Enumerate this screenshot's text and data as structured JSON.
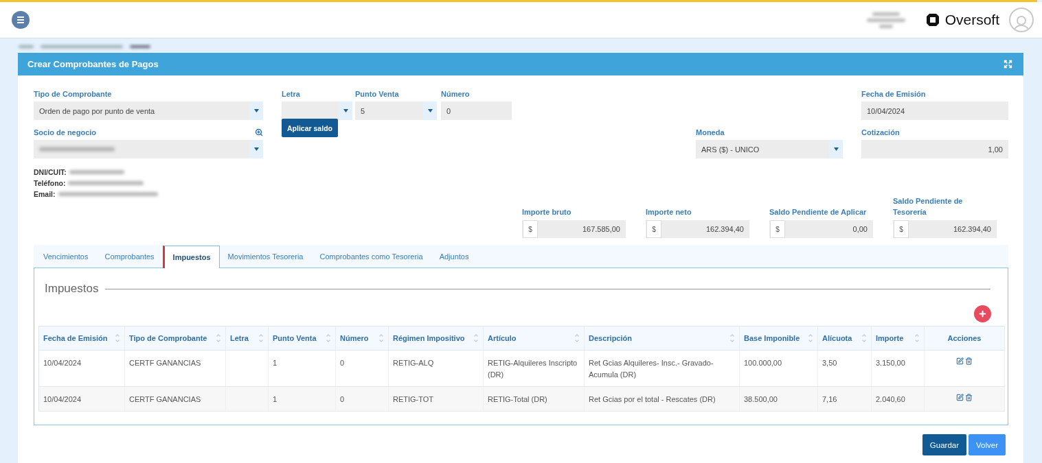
{
  "header": {
    "brand": "Oversoft",
    "user_redacted": true
  },
  "card": {
    "title": "Crear Comprobantes de Pagos"
  },
  "form": {
    "tipo_comprobante": {
      "label": "Tipo de Comprobante",
      "value": "Orden de pago por punto de venta",
      "kind": "select"
    },
    "letra": {
      "label": "Letra",
      "kind": "select"
    },
    "punto_venta": {
      "label": "Punto Venta",
      "value": "5",
      "kind": "select"
    },
    "numero": {
      "label": "Número",
      "value": "0",
      "kind": "text"
    },
    "fecha_emision": {
      "label": "Fecha de Emisión",
      "value": "10/04/2024",
      "kind": "text"
    },
    "socio_negocio": {
      "label": "Socio de negocio",
      "kind": "select",
      "redacted": true
    },
    "moneda": {
      "label": "Moneda",
      "value": "ARS ($) - UNICO",
      "kind": "select"
    },
    "cotizacion": {
      "label": "Cotización",
      "value": "1,00",
      "kind": "number"
    }
  },
  "apply_button": "Aplicar saldo",
  "contact": [
    {
      "label": "DNI/CUIT:",
      "redacted": true
    },
    {
      "label": "Teléfono:",
      "redacted": true
    },
    {
      "label": "Email:",
      "redacted": true
    }
  ],
  "amounts": [
    {
      "label": "Importe bruto",
      "currency": "$",
      "value": "167.585,00"
    },
    {
      "label": "Importe neto",
      "currency": "$",
      "value": "162.394,40"
    },
    {
      "label": "Saldo Pendiente de Aplicar",
      "currency": "$",
      "value": "0,00"
    },
    {
      "label": "Saldo Pendiente de Tesorería",
      "currency": "$",
      "value": "162.394,40"
    }
  ],
  "tabs": [
    {
      "label": "Vencimientos",
      "selected": false
    },
    {
      "label": "Comprobantes",
      "selected": false
    },
    {
      "label": "Impuestos",
      "selected": true
    },
    {
      "label": "Movimientos Tesoreria",
      "selected": false
    },
    {
      "label": "Comprobantes como Tesoreria",
      "selected": false
    },
    {
      "label": "Adjuntos",
      "selected": false
    }
  ],
  "section_title": "Impuestos",
  "table": {
    "columns": [
      {
        "label": "Fecha de Emisión",
        "sortable": true
      },
      {
        "label": "Tipo de Comprobante",
        "sortable": true
      },
      {
        "label": "Letra",
        "sortable": true
      },
      {
        "label": "Punto Venta",
        "sortable": true
      },
      {
        "label": "Número",
        "sortable": true
      },
      {
        "label": "Régimen Impositivo",
        "sortable": true
      },
      {
        "label": "Artículo",
        "sortable": true
      },
      {
        "label": "Descripción",
        "sortable": true
      },
      {
        "label": "Base Imponible",
        "sortable": true
      },
      {
        "label": "Alícuota",
        "sortable": true
      },
      {
        "label": "Importe",
        "sortable": true
      },
      {
        "label": "Acciones",
        "sortable": false
      }
    ],
    "rows": [
      {
        "cells": [
          "10/04/2024",
          "CERTF GANANCIAS",
          "",
          "1",
          "0",
          "RETIG-ALQ",
          "RETIG-Alquileres Inscripto (DR)",
          "Ret Gcias Alquileres- Insc.- Gravado-Acumula (DR)",
          "100.000,00",
          "3,50",
          "3.150,00"
        ]
      },
      {
        "cells": [
          "10/04/2024",
          "CERTF GANANCIAS",
          "",
          "1",
          "0",
          "RETIG-TOT",
          "RETIG-Total (DR)",
          "Ret Gcias por el total - Rescates (DR)",
          "38.500,00",
          "7,16",
          "2.040,60"
        ]
      }
    ]
  },
  "buttons": [
    {
      "label": "Guardar",
      "kind": "primary"
    },
    {
      "label": "Volver",
      "kind": "secondary"
    }
  ]
}
